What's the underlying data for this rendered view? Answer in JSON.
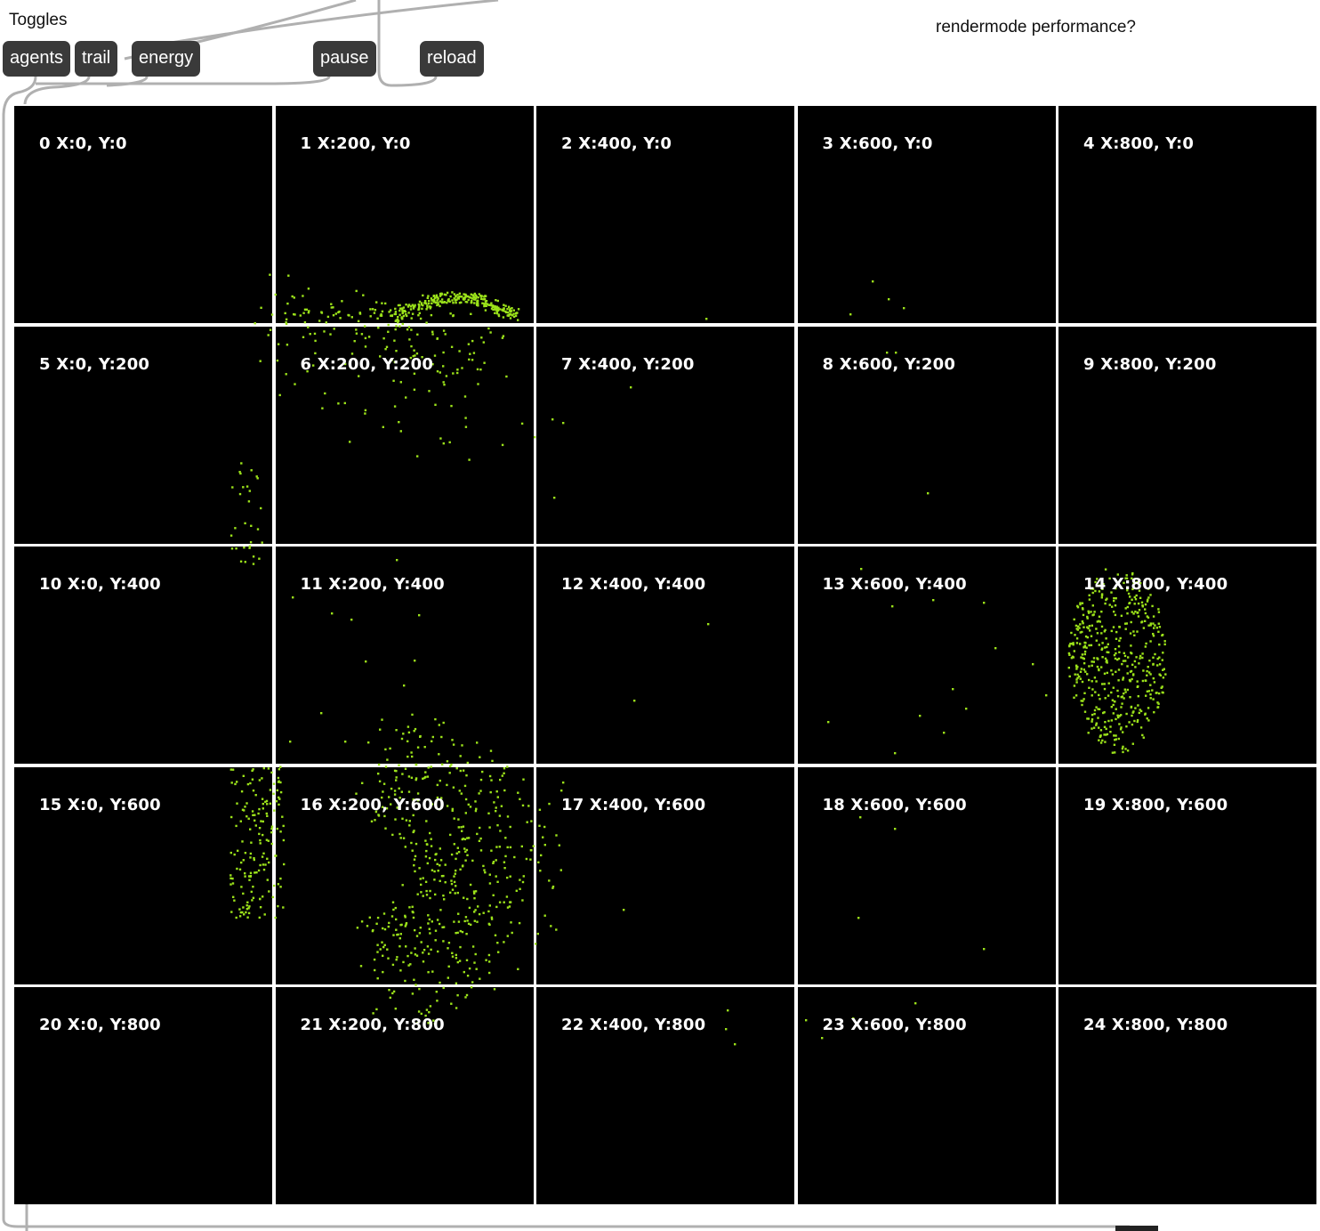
{
  "header": {
    "toggles_label": "Toggles",
    "perf_label": "rendermode performance?"
  },
  "buttons": {
    "agents": "agents",
    "trail": "trail",
    "energy": "energy",
    "pause": "pause",
    "reload": "reload"
  },
  "grid": {
    "cells": [
      "0 X:0, Y:0",
      "1 X:200, Y:0",
      "2 X:400, Y:0",
      "3 X:600, Y:0",
      "4 X:800, Y:0",
      "5 X:0, Y:200",
      "6 X:200, Y:200",
      "7 X:400, Y:200",
      "8 X:600, Y:200",
      "9 X:800, Y:200",
      "10 X:0, Y:400",
      "11 X:200, Y:400",
      "12 X:400, Y:400",
      "13 X:600, Y:400",
      "14 X:800, Y:400",
      "15 X:0, Y:600",
      "16 X:200, Y:600",
      "17 X:400, Y:600",
      "18 X:600, Y:600",
      "19 X:800, Y:600",
      "20 X:0, Y:800",
      "21 X:200, Y:800",
      "22 X:400, Y:800",
      "23 X:600, Y:800",
      "24 X:800, Y:800"
    ]
  },
  "colors": {
    "agent": "#9be21a",
    "cell_background": "#000000",
    "button_background": "#3a3a3a",
    "patch_line": "#b5b5b5"
  }
}
